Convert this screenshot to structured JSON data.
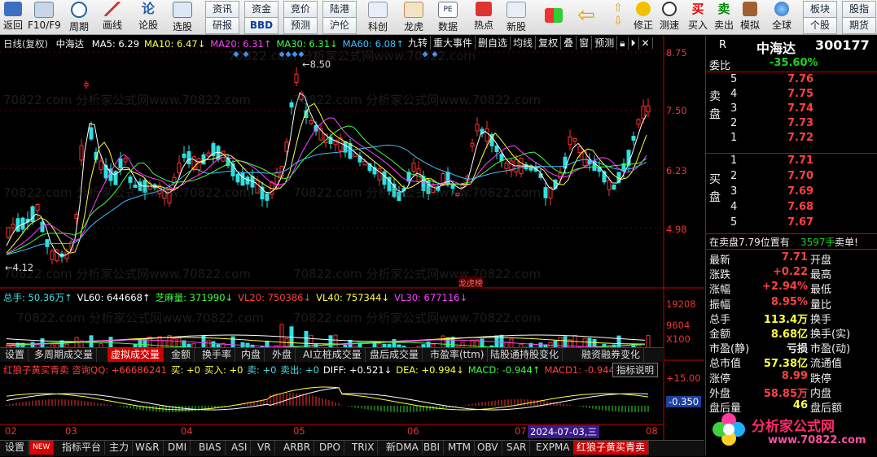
{
  "toolbar": {
    "buttons": [
      "返回",
      "F10/F9",
      "周期",
      "画线",
      "论股",
      "选股"
    ],
    "grid": [
      [
        "资讯",
        "资金",
        "竞价",
        "陆港"
      ],
      [
        "研报",
        "BBD",
        "预测",
        "沪伦"
      ]
    ],
    "buttons2": [
      "科创",
      "龙虎",
      "数据",
      "热点",
      "新股"
    ],
    "buttons3": [
      "修正",
      "测速",
      "买入",
      "卖出",
      "模拟",
      "全球"
    ],
    "grid2": [
      [
        "板块",
        "股指"
      ],
      [
        "个股",
        "期货"
      ]
    ]
  },
  "chart": {
    "title": "日线(复权)",
    "stock": "中海达",
    "ma": [
      {
        "label": "MA5: 6.29",
        "color": "#ffffff"
      },
      {
        "label": "MA10: 6.47↓",
        "color": "#ffff40"
      },
      {
        "label": "MA20: 6.31↑",
        "color": "#ff40ff"
      },
      {
        "label": "MA30: 6.31↓",
        "color": "#40ff40"
      },
      {
        "label": "MA60: 6.08↑",
        "color": "#40c0ff"
      }
    ],
    "right_tabs": [
      "九转",
      "重大事件",
      "删自选",
      "均线",
      "复权",
      "叠",
      "窗",
      "预测"
    ],
    "y_labels": [
      "8.75",
      "7.50",
      "6.23",
      "4.98"
    ],
    "high_label": "8.50",
    "low_label": "4.12",
    "marker": "龙虎榜",
    "watermark": "70822.com 分析家公式网www.70822.com"
  },
  "volume": {
    "header": [
      {
        "label": "总手: 50.36万↑",
        "color": "#40e0e0"
      },
      {
        "label": "VL60: 644668↑",
        "color": "#ffffff"
      },
      {
        "label": "芝麻量: 371990↓",
        "color": "#40ff40"
      },
      {
        "label": "VL20: 750386↓",
        "color": "#ff4040"
      },
      {
        "label": "VL40: 757344↓",
        "color": "#ffff40"
      },
      {
        "label": "VL30: 677116↓",
        "color": "#ff40ff"
      }
    ],
    "y_labels": [
      "19208",
      "9604",
      "X100"
    ]
  },
  "tabs1": [
    "设置",
    "多周期成交量",
    "虚拟成交量",
    "金额",
    "换手率",
    "内盘",
    "外盘",
    "AI立桩成交量",
    "盘后成交量",
    "市盈率(ttm)",
    "陆股通持股变化",
    "融资融券变化"
  ],
  "macd": {
    "header": [
      {
        "label": "红狼子黄买青卖 咨询QQ: +66686241",
        "color": "#ff4040"
      },
      {
        "label": "买: +0",
        "color": "#ffff40"
      },
      {
        "label": "买入: +0",
        "color": "#ffff40"
      },
      {
        "label": "卖: +0",
        "color": "#40e0e0"
      },
      {
        "label": "卖出: +0",
        "color": "#40e0e0"
      },
      {
        "label": "DIFF: +0.521↓",
        "color": "#ffffff"
      },
      {
        "label": "DEA: +0.994↓",
        "color": "#ffff40"
      },
      {
        "label": "MACD: -0.944↑",
        "color": "#40ff40"
      },
      {
        "label": "MACD1: -0.944↑",
        "color": "#ff4040"
      }
    ],
    "help": "指标说明",
    "y_labels": [
      "+15.00",
      "-0.350"
    ]
  },
  "xaxis": [
    "02",
    "03",
    "04",
    "05",
    "06",
    "07",
    "08"
  ],
  "date_badge": "2024-07-03,三",
  "tabs2": [
    "设置",
    "NEW",
    "指标平台",
    "主力",
    "W&R",
    "DMI",
    "BIAS",
    "ASI",
    "VR",
    "ARBR",
    "DPO",
    "TRIX",
    "新DMA",
    "BBI",
    "MTM",
    "OBV",
    "SAR",
    "EXPMA",
    "红狼子黄买青卖"
  ],
  "quote": {
    "r": "R",
    "name": "中海达",
    "code": "300177",
    "weibi_label": "委比",
    "weibi": "-35.60%",
    "sell_label": [
      "卖",
      "盘"
    ],
    "buy_label": [
      "买",
      "盘"
    ],
    "sells": [
      {
        "n": "5",
        "p": "7.76"
      },
      {
        "n": "4",
        "p": "7.75"
      },
      {
        "n": "3",
        "p": "7.74"
      },
      {
        "n": "2",
        "p": "7.73"
      },
      {
        "n": "1",
        "p": "7.72"
      }
    ],
    "buys": [
      {
        "n": "1",
        "p": "7.71"
      },
      {
        "n": "2",
        "p": "7.70"
      },
      {
        "n": "3",
        "p": "7.69"
      },
      {
        "n": "4",
        "p": "7.68"
      },
      {
        "n": "5",
        "p": "7.67"
      }
    ],
    "notice_a": "在卖盘7.79位置有",
    "notice_b": "3597手",
    "notice_c": "卖单!",
    "stats": [
      {
        "k": "最新",
        "v": "7.71",
        "k2": "开盘",
        "c": "red"
      },
      {
        "k": "涨跌",
        "v": "+0.22",
        "k2": "最高",
        "c": "red"
      },
      {
        "k": "涨幅",
        "v": "+2.94%",
        "k2": "最低",
        "c": "red"
      },
      {
        "k": "振幅",
        "v": "8.95%",
        "k2": "量比",
        "c": "red"
      },
      {
        "k": "总手",
        "v": "113.4万",
        "k2": "换手",
        "c": "yellow"
      },
      {
        "k": "金额",
        "v": "8.68亿",
        "k2": "换手(实)",
        "c": "yellow"
      },
      {
        "k": "市盈(静)",
        "v": "亏损",
        "k2": "市盈(动)",
        "c": "white"
      },
      {
        "k": "总市值",
        "v": "57.38亿",
        "k2": "流通值",
        "c": "yellow"
      },
      {
        "k": "涨停",
        "v": "8.99",
        "k2": "跌停",
        "c": "red"
      },
      {
        "k": "外盘",
        "v": "58.85万",
        "k2": "内盘",
        "c": "red"
      },
      {
        "k": "盘后量",
        "v": "46",
        "k2": "盘后额",
        "c": "yellow"
      }
    ],
    "logo_text": "分析家公式网",
    "logo_url": "www.70822.com"
  }
}
